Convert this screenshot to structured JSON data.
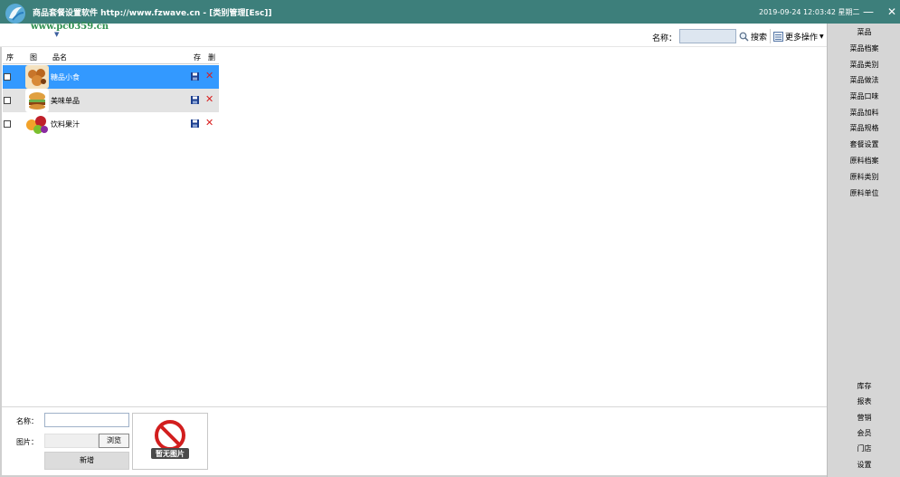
{
  "titlebar": {
    "title": "商品套餐设置软件 http://www.fzwave.cn - [类别管理[Esc]]",
    "clock": "2019-09-24 12:03:42 星期二",
    "min_label": "—",
    "close_label": "✕"
  },
  "watermark": "www.pc0359.cn",
  "toolbar": {
    "name_label": "名称：",
    "search_placeholder": "",
    "search_label": "搜索",
    "more_label": "更多操作"
  },
  "table": {
    "headers": [
      "序",
      "图",
      "品名",
      "存",
      "删"
    ],
    "rows": [
      {
        "name": "糖品小食",
        "selected": true
      },
      {
        "name": "美味单品",
        "selected": false
      },
      {
        "name": "饮料果汁",
        "selected": false
      }
    ]
  },
  "sidebar": {
    "top_items": [
      "菜品",
      "菜品档案",
      "菜品类别",
      "菜品做法",
      "菜品口味",
      "菜品加料",
      "菜品规格",
      "套餐设置",
      "原料档案",
      "原料类别",
      "原料单位"
    ],
    "bottom_items": [
      "库存",
      "报表",
      "营销",
      "会员",
      "门店",
      "设置"
    ]
  },
  "form": {
    "name_label": "名称：",
    "name_value": "",
    "image_label": "图片：",
    "browse_label": "浏览",
    "add_label": "新增",
    "no_image_text": "暂无图片"
  },
  "colors": {
    "titlebar": "#3d7f7b",
    "selected_row": "#3399ff",
    "alt_row": "#e3e3e3",
    "sidebar": "#d6d6d6"
  }
}
